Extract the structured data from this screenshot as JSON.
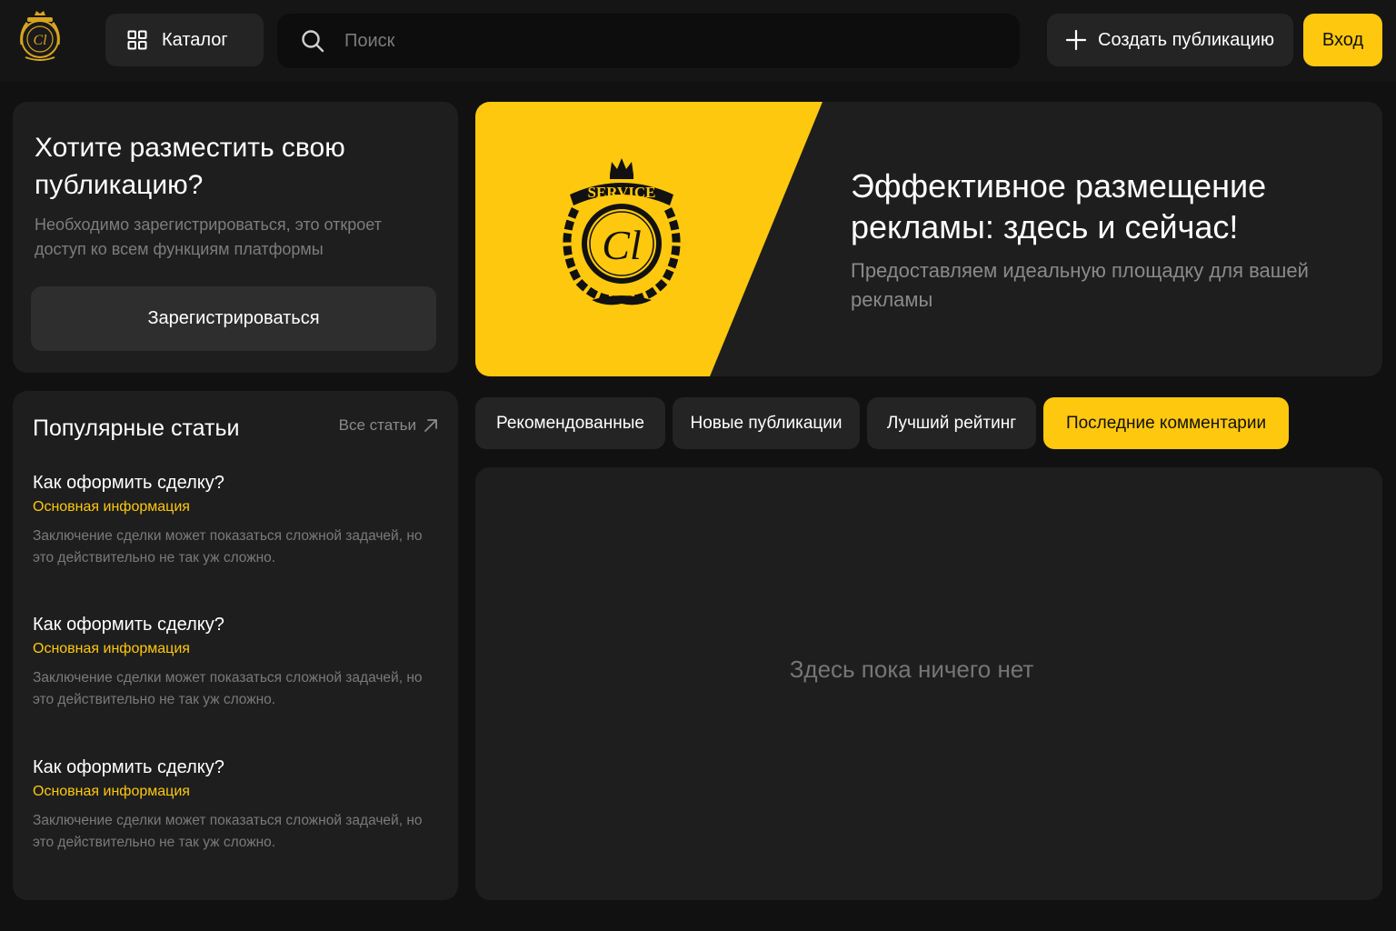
{
  "header": {
    "catalog_label": "Каталог",
    "search_placeholder": "Поиск",
    "create_label": "Создать публикацию",
    "login_label": "Вход"
  },
  "register_card": {
    "title": "Хотите разместить свою публикацию?",
    "text": "Необходимо зарегистрироваться, это откроет доступ ко всем функциям платформы",
    "button_label": "Зарегистрироваться"
  },
  "popular_articles": {
    "title": "Популярные статьи",
    "all_label": "Все статьи",
    "items": [
      {
        "title": "Как оформить сделку?",
        "category": "Основная информация",
        "text": "Заключение сделки может показаться сложной задачей, но это действительно не так уж сложно."
      },
      {
        "title": "Как оформить сделку?",
        "category": "Основная информация",
        "text": "Заключение сделки может показаться сложной задачей, но это действительно не так уж сложно."
      },
      {
        "title": "Как оформить сделку?",
        "category": "Основная информация",
        "text": "Заключение сделки может показаться сложной задачей, но это действительно не так уж сложно."
      }
    ]
  },
  "banner": {
    "title": "Эффективное размещение рекламы: здесь и сейчас!",
    "text": "Предоставляем идеальную площадку для вашей рекламы",
    "emblem_text": "SERVICE",
    "emblem_monogram": "Cl"
  },
  "tabs": [
    {
      "label": "Рекомендованные",
      "active": false
    },
    {
      "label": "Новые публикации",
      "active": false
    },
    {
      "label": "Лучший рейтинг",
      "active": false
    },
    {
      "label": "Последние комментарии",
      "active": true
    }
  ],
  "content": {
    "empty_text": "Здесь пока ничего нет"
  },
  "colors": {
    "accent": "#fdc80e",
    "background": "#111111",
    "card": "#1e1e1e",
    "button": "#242424"
  },
  "icons": {
    "logo": "crest-logo-icon",
    "catalog": "grid-icon",
    "search": "search-icon",
    "create": "plus-icon",
    "all_articles": "arrow-up-right-icon"
  }
}
